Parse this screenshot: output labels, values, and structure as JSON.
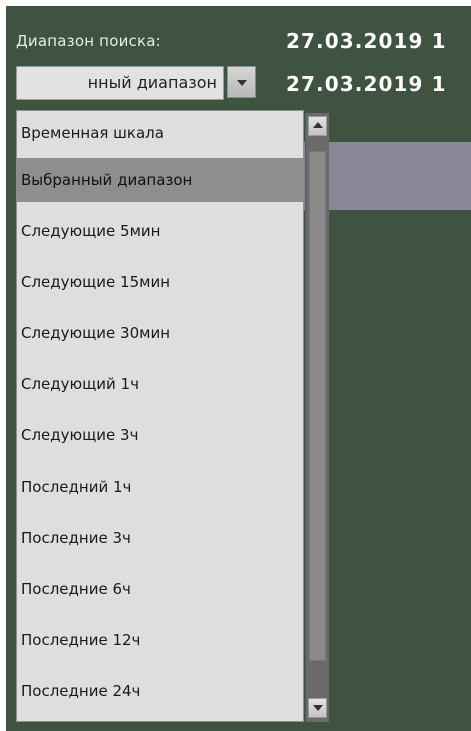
{
  "search": {
    "label": "Диапазон поиска:",
    "date_start": "27.03.2019 1",
    "date_end": "27.03.2019 1"
  },
  "combo": {
    "value": "нный диапазон"
  },
  "dropdown": {
    "options": [
      "Временная шкала",
      "Выбранный диапазон",
      "Следующие 5мин",
      "Следующие 15мин",
      "Следующие 30мин",
      "Следующий 1ч",
      "Следующие 3ч",
      "Последний 1ч",
      "Последние 3ч",
      "Последние 6ч",
      "Последние 12ч",
      "Последние 24ч"
    ],
    "selected": "Выбранный диапазон"
  },
  "icons": {
    "combo_arrow": "chevron-down-icon",
    "scroll_up": "chevron-up-icon",
    "scroll_down": "chevron-down-icon"
  },
  "colors": {
    "panel_bg": "#3e5440",
    "dropdown_bg": "#dedede",
    "selected_bg": "#8e8e8e",
    "highlight_bg": "#878796"
  }
}
